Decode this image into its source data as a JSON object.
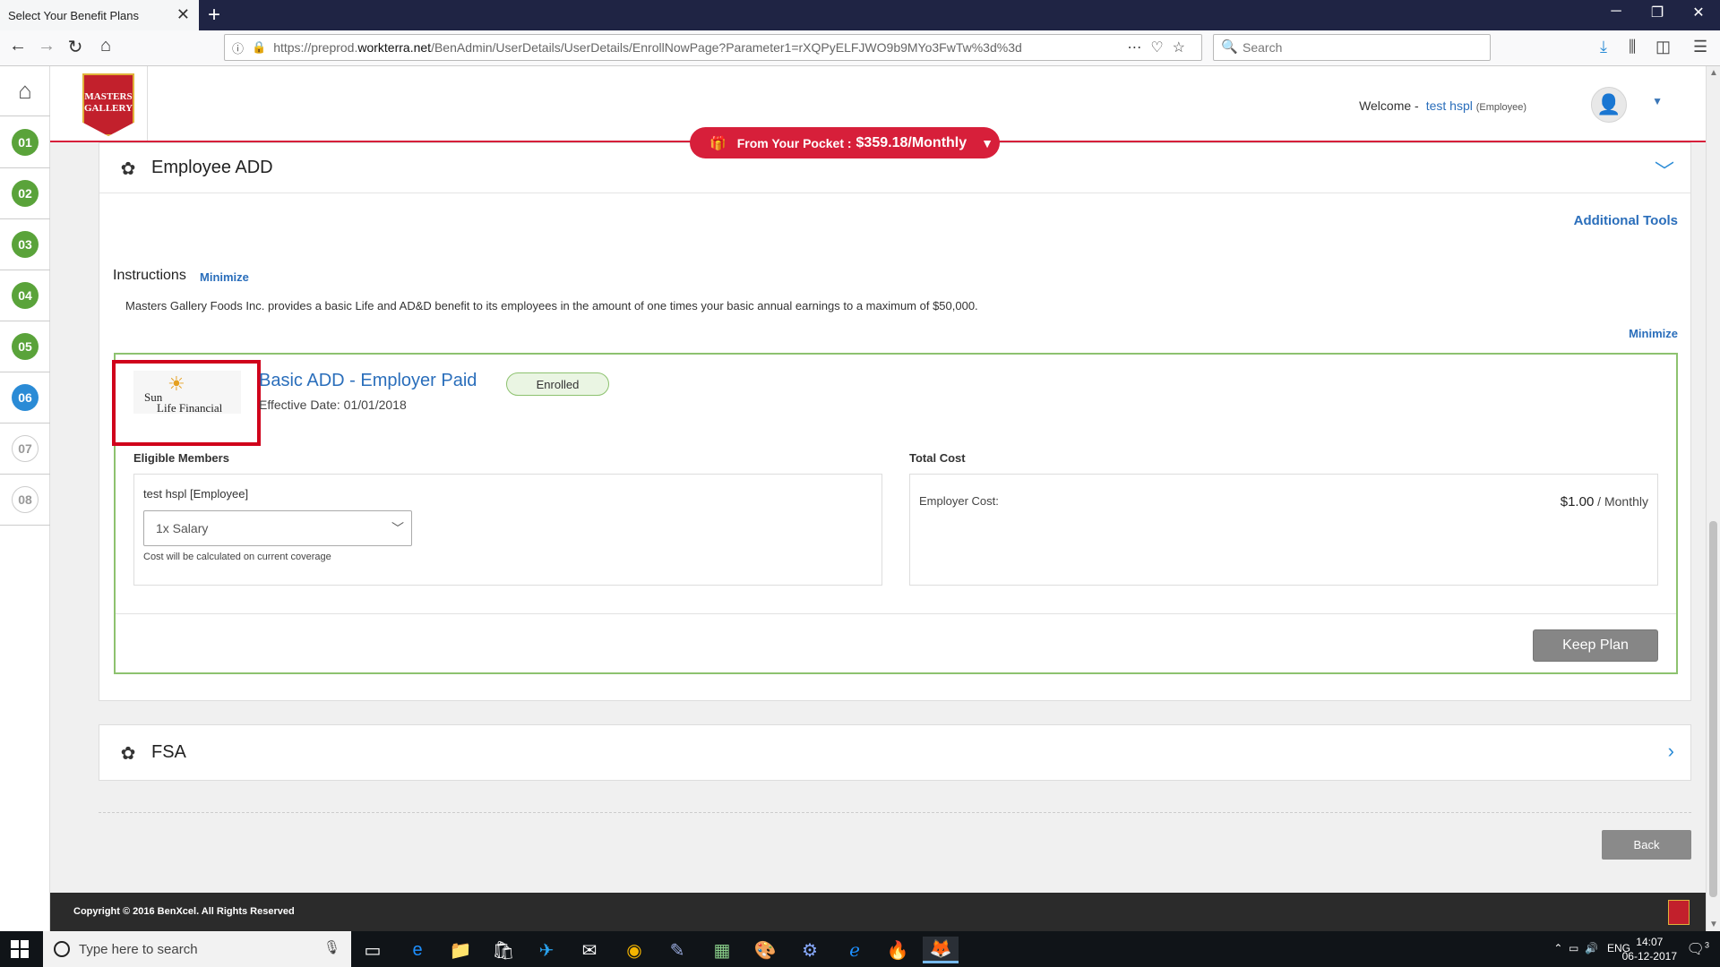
{
  "browser": {
    "tab_title": "Select Your Benefit Plans",
    "url_prefix": "https://preprod.",
    "url_domain": "workterra.net",
    "url_path": "/BenAdmin/UserDetails/UserDetails/EnrollNowPage?Parameter1=rXQPyELFJWO9b9MYo3FwTw%3d%3d",
    "search_placeholder": "Search"
  },
  "rail": {
    "steps": [
      "01",
      "02",
      "03",
      "04",
      "05",
      "06",
      "07",
      "08"
    ],
    "current_step": "06"
  },
  "header": {
    "logo_text": "MASTERS GALLERY",
    "welcome_label": "Welcome -",
    "user_name": "test hspl",
    "user_role": "(Employee)"
  },
  "pocket": {
    "label": "From Your Pocket :",
    "amount": "$359.18/Monthly"
  },
  "add_section": {
    "title": "Employee ADD",
    "additional_tools": "Additional Tools",
    "instructions_title": "Instructions",
    "minimize_label": "Minimize",
    "instructions_text": "Masters Gallery Foods Inc. provides a basic Life and AD&D benefit to its employees in the amount of one times your basic annual earnings to a maximum of $50,000.",
    "minimize_label_2": "Minimize"
  },
  "plan": {
    "carrier_logo_line1": "Sun",
    "carrier_logo_line2": "Life Financial",
    "name": "Basic ADD - Employer Paid",
    "status": "Enrolled",
    "effective_date": "Effective Date: 01/01/2018",
    "eligible_label": "Eligible Members",
    "member": "test hspl [Employee]",
    "coverage_selected": "1x Salary",
    "coverage_note": "Cost will be calculated on current coverage",
    "total_cost_label": "Total Cost",
    "employer_cost_label": "Employer Cost:",
    "employer_cost_value": "$1.00",
    "employer_cost_period": " / Monthly",
    "keep_button": "Keep Plan"
  },
  "fsa_section": {
    "title": "FSA"
  },
  "back_button": "Back",
  "footer": {
    "copyright": "Copyright © 2016 BenXcel. All Rights Reserved"
  },
  "taskbar": {
    "search_placeholder": "Type here to search",
    "language": "ENG",
    "time": "14:07",
    "date": "06-12-2017",
    "notification_count": "3"
  },
  "colors": {
    "accent_red": "#d71f3a",
    "link_blue": "#2a6ebb",
    "step_done": "#5aa33a",
    "step_current": "#2a8bd6",
    "card_border": "#8dc26f"
  }
}
